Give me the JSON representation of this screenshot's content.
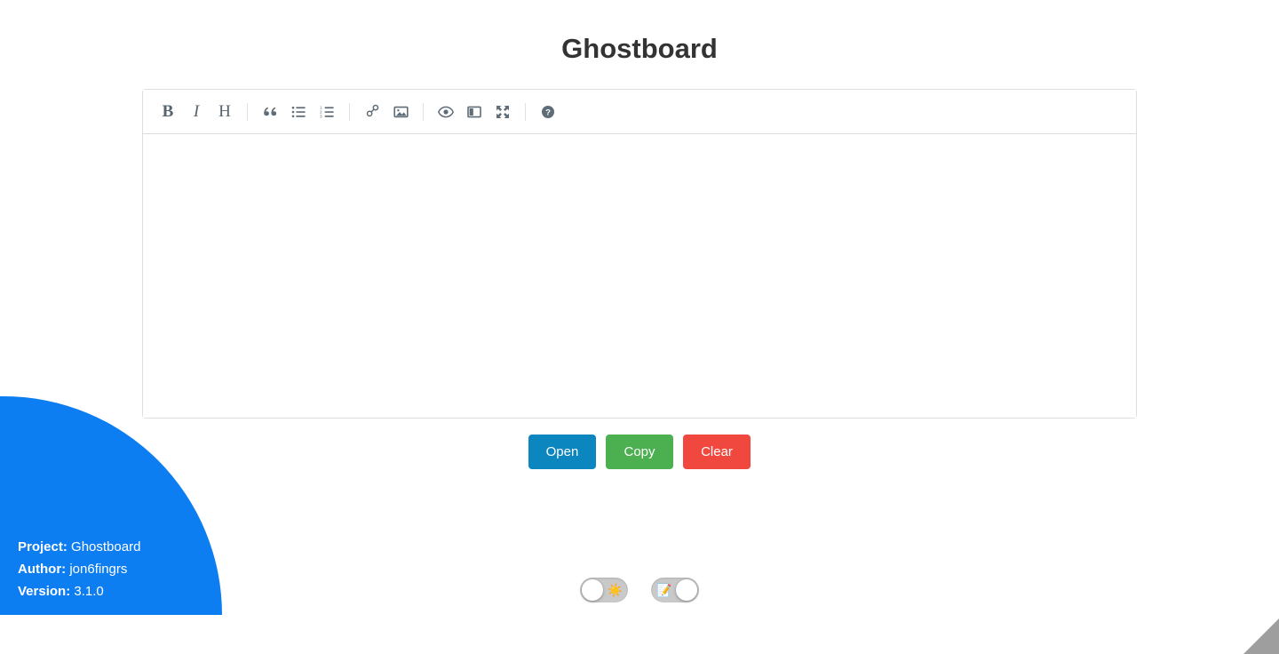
{
  "app": {
    "title": "Ghostboard",
    "background": "#ffffff",
    "title_color": "#333333"
  },
  "editor": {
    "content": "",
    "placeholder": "",
    "border_color": "#dddddd",
    "toolbar": {
      "groups": [
        {
          "items": [
            {
              "name": "bold-icon",
              "label": "B",
              "tooltip": "Bold"
            },
            {
              "name": "italic-icon",
              "label": "I",
              "tooltip": "Italic"
            },
            {
              "name": "heading-icon",
              "label": "H",
              "tooltip": "Heading"
            }
          ]
        },
        {
          "items": [
            {
              "name": "quote-icon",
              "label": "“",
              "tooltip": "Quote"
            },
            {
              "name": "unordered-list-icon",
              "label": "",
              "tooltip": "Generic List"
            },
            {
              "name": "ordered-list-icon",
              "label": "",
              "tooltip": "Numbered List"
            }
          ]
        },
        {
          "items": [
            {
              "name": "link-icon",
              "label": "",
              "tooltip": "Create Link"
            },
            {
              "name": "image-icon",
              "label": "",
              "tooltip": "Insert Image"
            }
          ]
        },
        {
          "items": [
            {
              "name": "preview-icon",
              "label": "",
              "tooltip": "Toggle Preview"
            },
            {
              "name": "side-by-side-icon",
              "label": "",
              "tooltip": "Toggle Side by Side"
            },
            {
              "name": "fullscreen-icon",
              "label": "",
              "tooltip": "Toggle Fullscreen"
            }
          ]
        },
        {
          "items": [
            {
              "name": "help-icon",
              "label": "",
              "tooltip": "Markdown Guide"
            }
          ]
        }
      ],
      "icon_color": "#5f6d78"
    }
  },
  "actions": {
    "open_label": "Open",
    "copy_label": "Copy",
    "clear_label": "Clear",
    "open_color": "#0c86bf",
    "copy_color": "#4cb050",
    "clear_color": "#f0483e"
  },
  "toggles": [
    {
      "name": "theme-toggle",
      "emoji": "☀️",
      "emoji_name": "sun-icon",
      "state": "off",
      "track_color": "#c9c9c9"
    },
    {
      "name": "editor-mode-toggle",
      "emoji": "📝",
      "emoji_name": "memo-icon",
      "state": "on",
      "track_color": "#c9c9c9"
    }
  ],
  "corner_badge": {
    "background": "#0d7df2",
    "rows": [
      {
        "key": "Project:",
        "value": "Ghostboard"
      },
      {
        "key": "Author:",
        "value": "jon6fingrs"
      },
      {
        "key": "Version:",
        "value": "3.1.0"
      }
    ]
  },
  "resize_grabber": {
    "name": "resize-grabber",
    "color": "#9e9e9e"
  }
}
